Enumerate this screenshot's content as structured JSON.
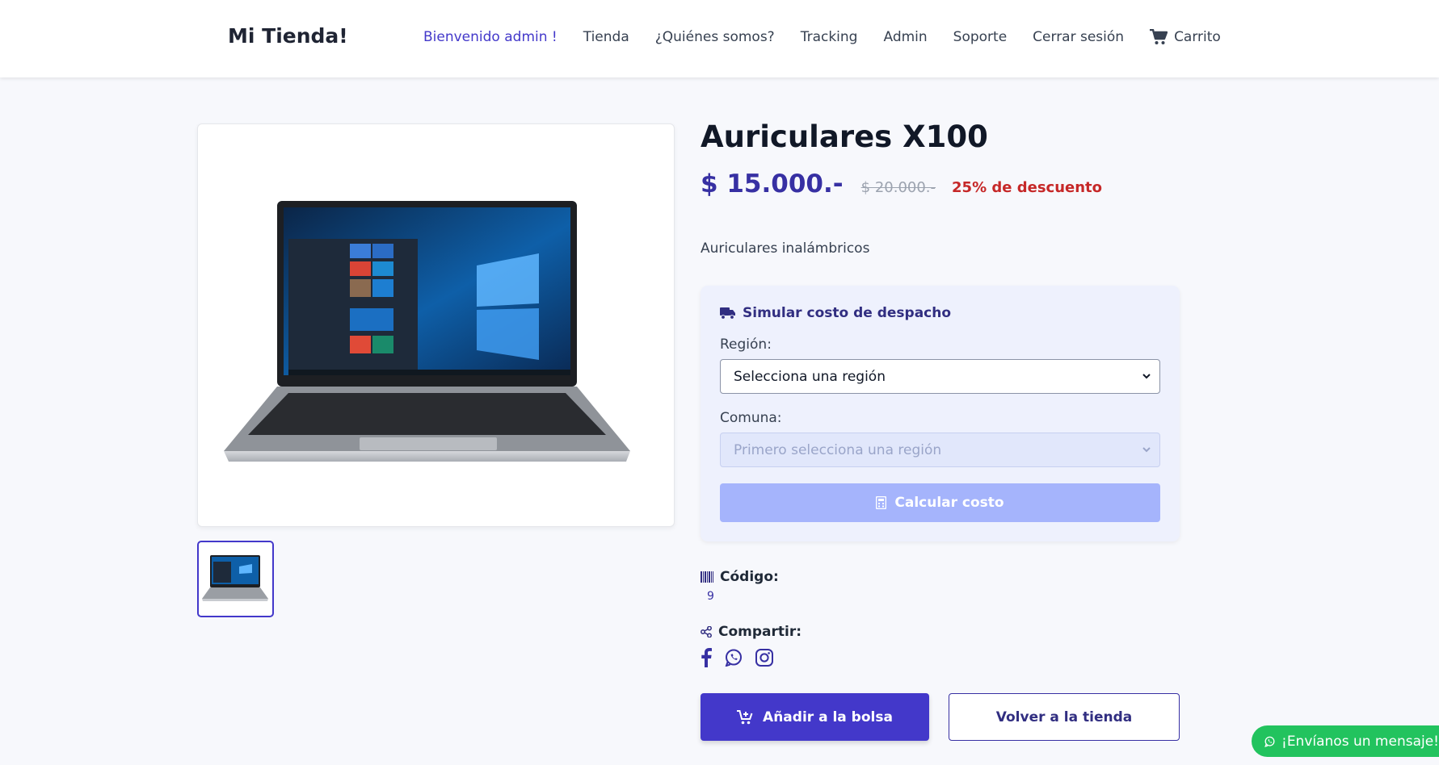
{
  "header": {
    "brand": "Mi Tienda!",
    "nav": {
      "welcome": "Bienvenido admin !",
      "shop": "Tienda",
      "about": "¿Quiénes somos?",
      "tracking": "Tracking",
      "admin": "Admin",
      "support": "Soporte",
      "logout": "Cerrar sesión",
      "cart": "Carrito"
    }
  },
  "product": {
    "title": "Auriculares X100",
    "price": "$ 15.000.-",
    "old_price": "$ 20.000.-",
    "discount": "25% de descuento",
    "description": "Auriculares inalámbricos"
  },
  "shipping": {
    "title": "Simular costo de despacho",
    "region_label": "Región:",
    "region_value": "Selecciona una región",
    "commune_label": "Comuna:",
    "commune_value": "Primero selecciona una región",
    "calc_label": "Calcular costo"
  },
  "code": {
    "label": "Código:",
    "value": "9"
  },
  "share": {
    "label": "Compartir:",
    "networks": [
      "facebook-icon",
      "whatsapp-icon",
      "instagram-icon"
    ]
  },
  "actions": {
    "add_label": "Añadir a la bolsa",
    "back_label": "Volver a la tienda"
  },
  "whatsapp": {
    "label": "¡Envíanos un mensaje!"
  },
  "colors": {
    "accent": "#4338ca",
    "discount": "#c62828",
    "whatsapp": "#22c35e",
    "card": "#eef1fd"
  }
}
